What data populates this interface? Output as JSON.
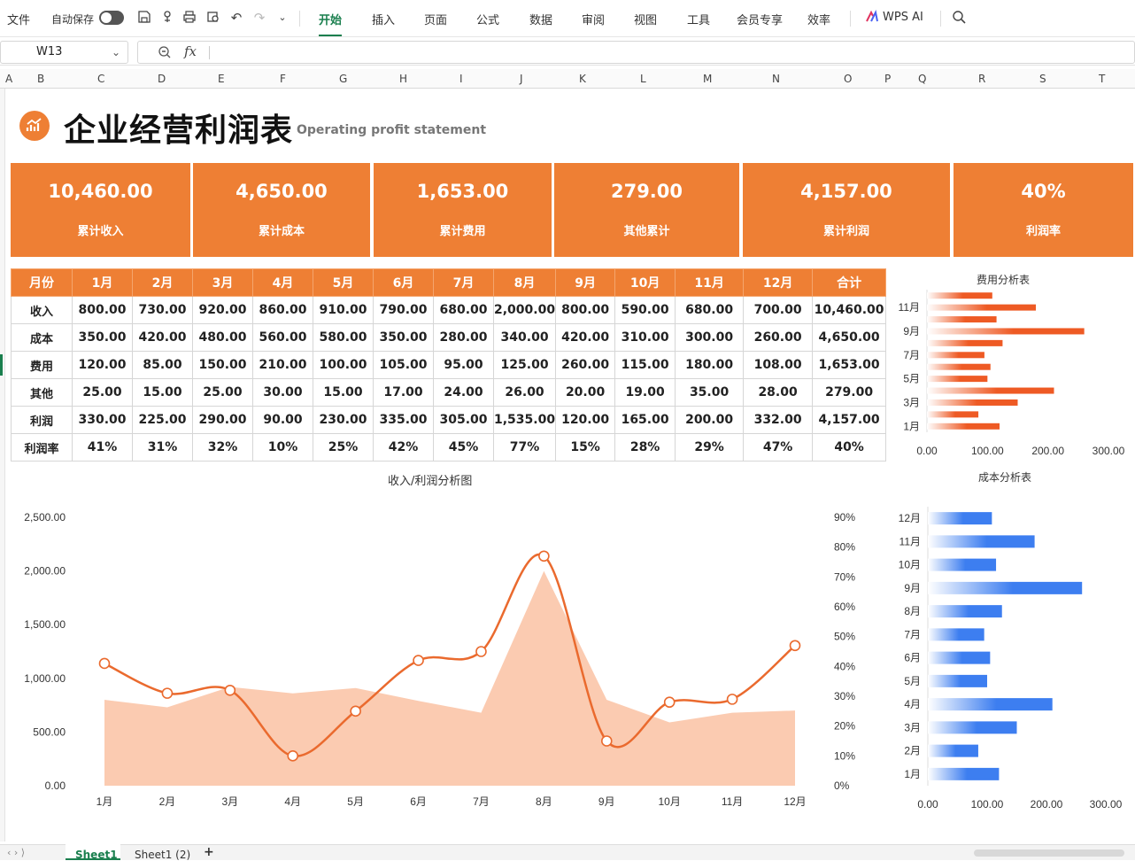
{
  "toolbar": {
    "file": "文件",
    "autosave": "自动保存",
    "menus": [
      "开始",
      "插入",
      "页面",
      "公式",
      "数据",
      "审阅",
      "视图",
      "工具",
      "会员专享",
      "效率"
    ],
    "ai": "WPS AI"
  },
  "formula_bar": {
    "cell_ref": "W13",
    "fx": "fx"
  },
  "columns": [
    "A",
    "B",
    "C",
    "D",
    "E",
    "F",
    "G",
    "H",
    "I",
    "J",
    "K",
    "L",
    "M",
    "N",
    "O",
    "P",
    "Q",
    "R",
    "S",
    "T"
  ],
  "header": {
    "title": "企业经营利润表",
    "subtitle": "Operating profit statement"
  },
  "kpis": [
    {
      "value": "10,460.00",
      "label": "累计收入"
    },
    {
      "value": "4,650.00",
      "label": "累计成本"
    },
    {
      "value": "1,653.00",
      "label": "累计费用"
    },
    {
      "value": "279.00",
      "label": "其他累计"
    },
    {
      "value": "4,157.00",
      "label": "累计利润"
    },
    {
      "value": "40%",
      "label": "利润率"
    }
  ],
  "table": {
    "headers": [
      "月份",
      "1月",
      "2月",
      "3月",
      "4月",
      "5月",
      "6月",
      "7月",
      "8月",
      "9月",
      "10月",
      "11月",
      "12月",
      "合计"
    ],
    "rows": [
      [
        "收入",
        "800.00",
        "730.00",
        "920.00",
        "860.00",
        "910.00",
        "790.00",
        "680.00",
        "2,000.00",
        "800.00",
        "590.00",
        "680.00",
        "700.00",
        "10,460.00"
      ],
      [
        "成本",
        "350.00",
        "420.00",
        "480.00",
        "560.00",
        "580.00",
        "350.00",
        "280.00",
        "340.00",
        "420.00",
        "310.00",
        "300.00",
        "260.00",
        "4,650.00"
      ],
      [
        "费用",
        "120.00",
        "85.00",
        "150.00",
        "210.00",
        "100.00",
        "105.00",
        "95.00",
        "125.00",
        "260.00",
        "115.00",
        "180.00",
        "108.00",
        "1,653.00"
      ],
      [
        "其他",
        "25.00",
        "15.00",
        "25.00",
        "30.00",
        "15.00",
        "17.00",
        "24.00",
        "26.00",
        "20.00",
        "19.00",
        "35.00",
        "28.00",
        "279.00"
      ],
      [
        "利润",
        "330.00",
        "225.00",
        "290.00",
        "90.00",
        "230.00",
        "335.00",
        "305.00",
        "1,535.00",
        "120.00",
        "165.00",
        "200.00",
        "332.00",
        "4,157.00"
      ],
      [
        "利润率",
        "41%",
        "31%",
        "32%",
        "10%",
        "25%",
        "42%",
        "45%",
        "77%",
        "15%",
        "28%",
        "29%",
        "47%",
        "40%"
      ]
    ]
  },
  "chart_data": [
    {
      "type": "area",
      "title": "收入/利润分析图",
      "categories": [
        "1月",
        "2月",
        "3月",
        "4月",
        "5月",
        "6月",
        "7月",
        "8月",
        "9月",
        "10月",
        "11月",
        "12月"
      ],
      "series": [
        {
          "name": "收入",
          "type": "area",
          "axis": "left",
          "values": [
            800,
            730,
            920,
            860,
            910,
            790,
            680,
            2000,
            800,
            590,
            680,
            700
          ],
          "color": "#fbcbb1"
        },
        {
          "name": "利润率",
          "type": "line",
          "axis": "right",
          "values": [
            0.41,
            0.31,
            0.32,
            0.1,
            0.25,
            0.42,
            0.45,
            0.77,
            0.15,
            0.28,
            0.29,
            0.47
          ],
          "color": "#ea6a2e"
        }
      ],
      "y_left": {
        "ticks": [
          "0.00",
          "500.00",
          "1,000.00",
          "1,500.00",
          "2,000.00",
          "2,500.00"
        ],
        "max": 2500
      },
      "y_right": {
        "ticks": [
          "0%",
          "10%",
          "20%",
          "30%",
          "40%",
          "50%",
          "60%",
          "70%",
          "80%",
          "90%"
        ],
        "max": 0.9
      }
    },
    {
      "type": "bar",
      "orientation": "horizontal",
      "title": "费用分析表",
      "categories": [
        "1月",
        "2月",
        "3月",
        "4月",
        "5月",
        "6月",
        "7月",
        "8月",
        "9月",
        "10月",
        "11月",
        "12月"
      ],
      "category_labels": [
        "1月",
        "3月",
        "5月",
        "7月",
        "9月",
        "11月"
      ],
      "values": [
        120,
        85,
        150,
        210,
        100,
        105,
        95,
        125,
        260,
        115,
        180,
        108
      ],
      "x_ticks": [
        "0.00",
        "100.00",
        "200.00",
        "300.00"
      ],
      "xlim": [
        0,
        300
      ],
      "color": "#ee5a24"
    },
    {
      "type": "bar",
      "orientation": "horizontal",
      "title": "成本分析表",
      "categories": [
        "1月",
        "2月",
        "3月",
        "4月",
        "5月",
        "6月",
        "7月",
        "8月",
        "9月",
        "10月",
        "11月",
        "12月"
      ],
      "values": [
        120,
        85,
        150,
        210,
        100,
        105,
        95,
        125,
        260,
        115,
        180,
        108
      ],
      "x_ticks": [
        "0.00",
        "100.00",
        "200.00",
        "300.00"
      ],
      "xlim": [
        0,
        300
      ],
      "color": "#3d7ef0"
    }
  ],
  "sheets": [
    "Sheet1",
    "Sheet1 (2)"
  ],
  "colors": {
    "accent": "#ee7f34",
    "green": "#1a7f4e"
  }
}
